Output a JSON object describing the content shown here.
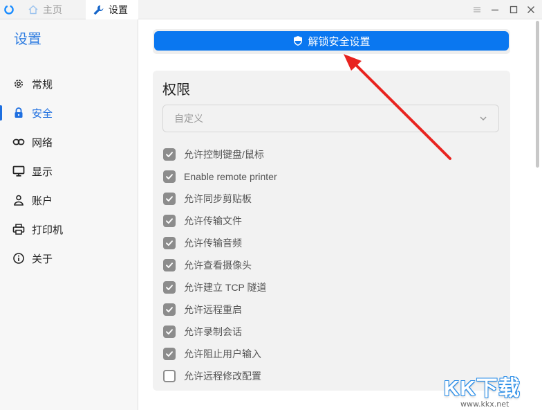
{
  "titlebar": {
    "tabs": [
      {
        "label": "主页",
        "icon": "home-icon"
      },
      {
        "label": "设置",
        "icon": "wrench-icon"
      }
    ],
    "window_controls": [
      "menu-icon",
      "minimize-icon",
      "maximize-icon",
      "close-icon"
    ]
  },
  "sidebar": {
    "title": "设置",
    "active_index": 1,
    "items": [
      {
        "label": "常规",
        "icon": "gear-icon"
      },
      {
        "label": "安全",
        "icon": "lock-icon"
      },
      {
        "label": "网络",
        "icon": "link-icon"
      },
      {
        "label": "显示",
        "icon": "monitor-icon"
      },
      {
        "label": "账户",
        "icon": "user-icon"
      },
      {
        "label": "打印机",
        "icon": "printer-icon"
      },
      {
        "label": "关于",
        "icon": "info-icon"
      }
    ]
  },
  "main": {
    "unlock_button": {
      "label": "解锁安全设置",
      "icon": "shield-icon"
    },
    "permissions": {
      "title": "权限",
      "preset_select": {
        "value": "自定义"
      },
      "items": [
        {
          "label": "允许控制键盘/鼠标",
          "checked": true
        },
        {
          "label": "Enable remote printer",
          "checked": true
        },
        {
          "label": "允许同步剪贴板",
          "checked": true
        },
        {
          "label": "允许传输文件",
          "checked": true
        },
        {
          "label": "允许传输音频",
          "checked": true
        },
        {
          "label": "允许查看摄像头",
          "checked": true
        },
        {
          "label": "允许建立 TCP 隧道",
          "checked": true
        },
        {
          "label": "允许远程重启",
          "checked": true
        },
        {
          "label": "允许录制会话",
          "checked": true
        },
        {
          "label": "允许阻止用户输入",
          "checked": true
        },
        {
          "label": "允许远程修改配置",
          "checked": false
        }
      ]
    }
  },
  "annotation": {
    "color": "#e8231f"
  },
  "watermark": {
    "letters": "KK下载",
    "url": "www.kkx.net"
  },
  "colors": {
    "accent": "#0a77f0",
    "sidebar_active": "#1e6fe0",
    "checkbox": "#8c8c8c"
  }
}
